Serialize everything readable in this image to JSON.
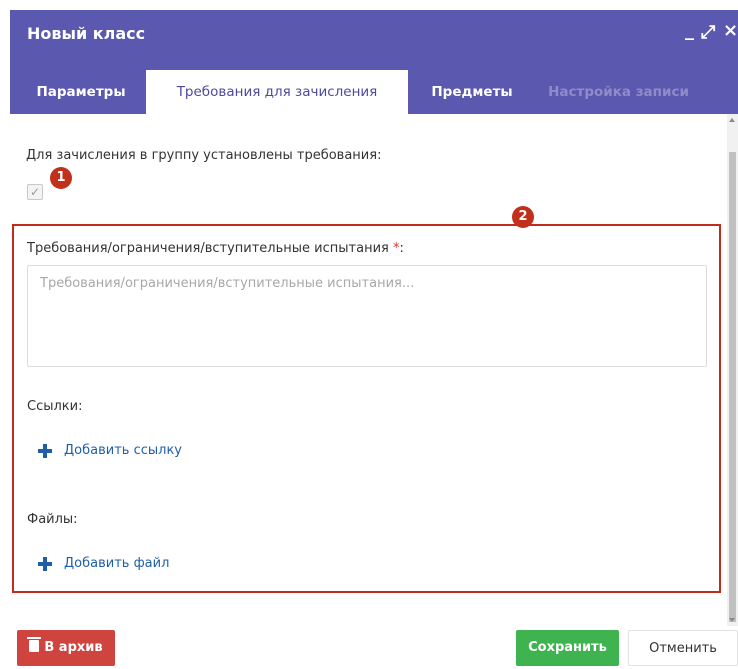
{
  "dialog": {
    "title": "Новый класс",
    "controls": {
      "minimize": "_",
      "maximize": "⤢",
      "close": "×"
    }
  },
  "tabs": [
    {
      "label": "Параметры",
      "state": "inactive"
    },
    {
      "label": "Требования для зачисления",
      "state": "active"
    },
    {
      "label": "Предметы",
      "state": "inactive"
    },
    {
      "label": "Настройка записи",
      "state": "disabled"
    }
  ],
  "form": {
    "requirements_flag_label": "Для зачисления в группу установлены требования:",
    "requirements_flag_checked": true,
    "checkmark": "✓",
    "markers": [
      "1",
      "2"
    ],
    "requirements_label": "Требования/ограничения/вступительные испытания",
    "required_mark": "*",
    "label_colon": ":",
    "requirements_value": "",
    "requirements_placeholder": "Требования/ограничения/вступительные испытания...",
    "links_label": "Ссылки:",
    "add_link_label": "Добавить ссылку",
    "files_label": "Файлы:",
    "add_file_label": "Добавить файл"
  },
  "footer": {
    "archive_label": "В архив",
    "save_label": "Сохранить",
    "cancel_label": "Отменить"
  },
  "colors": {
    "header": "#5b58b0",
    "accent_link": "#1f5fa8",
    "marker": "#c0301a",
    "archive": "#d0443f",
    "save": "#3fb34f"
  }
}
